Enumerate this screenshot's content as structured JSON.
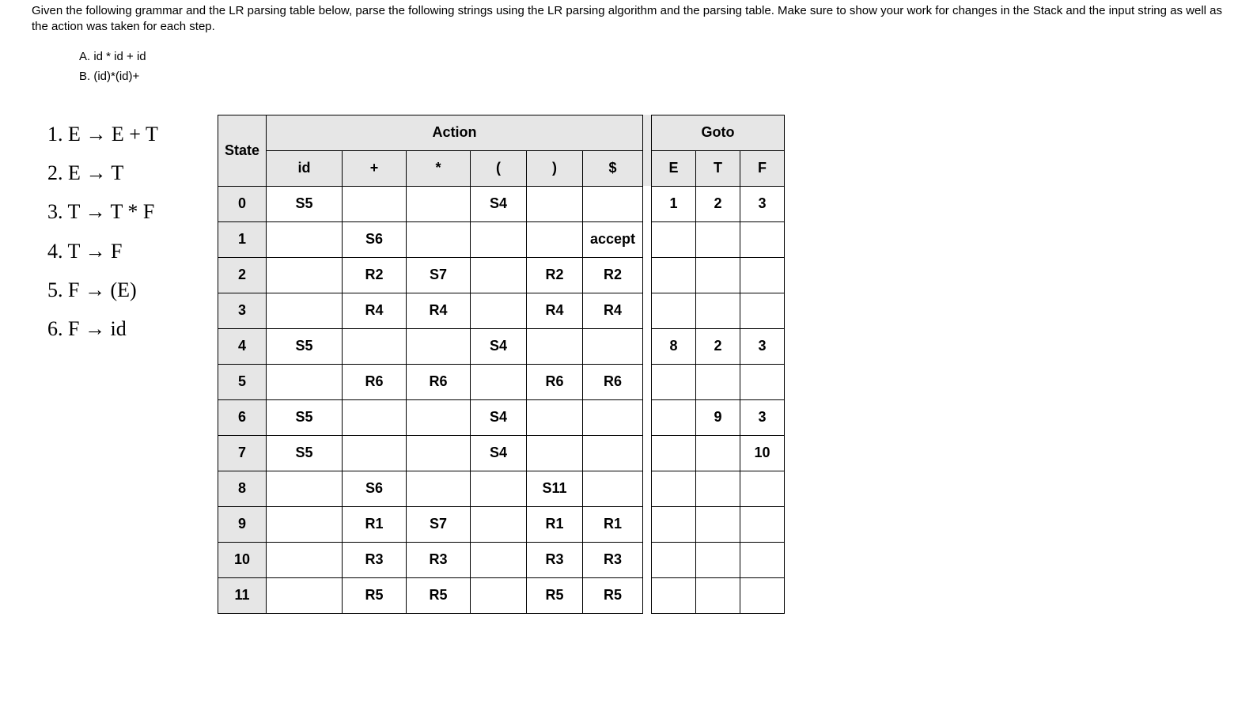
{
  "prompt": "Given the following grammar and the LR parsing table below, parse the following strings using the LR parsing algorithm and the parsing table. Make sure to show your work for changes in the Stack and the input string as well as the action was taken for each step.",
  "options": {
    "A": "A. id * id + id",
    "B": "B. (id)*(id)+"
  },
  "grammar": [
    {
      "n": "1.",
      "lhs": "E",
      "rhs": "E + T"
    },
    {
      "n": "2.",
      "lhs": "E",
      "rhs": "T"
    },
    {
      "n": "3.",
      "lhs": "T",
      "rhs": "T * F"
    },
    {
      "n": "4.",
      "lhs": "T",
      "rhs": "F"
    },
    {
      "n": "5.",
      "lhs": "F",
      "rhs": " (E)"
    },
    {
      "n": "6.",
      "lhs": "F",
      "rhs": "id"
    }
  ],
  "headers": {
    "action": "Action",
    "goto": "Goto",
    "state": "State",
    "id": "id",
    "plus": "+",
    "star": "*",
    "lp": "(",
    "rp": ")",
    "dollar": "$",
    "E": "E",
    "T": "T",
    "F": "F"
  },
  "rows": [
    {
      "s": "0",
      "id": "S5",
      "plus": "",
      "star": "",
      "lp": "S4",
      "rp": "",
      "dol": "",
      "E": "1",
      "T": "2",
      "F": "3"
    },
    {
      "s": "1",
      "id": "",
      "plus": "S6",
      "star": "",
      "lp": "",
      "rp": "",
      "dol": "accept",
      "E": "",
      "T": "",
      "F": ""
    },
    {
      "s": "2",
      "id": "",
      "plus": "R2",
      "star": "S7",
      "lp": "",
      "rp": "R2",
      "dol": "R2",
      "E": "",
      "T": "",
      "F": ""
    },
    {
      "s": "3",
      "id": "",
      "plus": "R4",
      "star": "R4",
      "lp": "",
      "rp": "R4",
      "dol": "R4",
      "E": "",
      "T": "",
      "F": ""
    },
    {
      "s": "4",
      "id": "S5",
      "plus": "",
      "star": "",
      "lp": "S4",
      "rp": "",
      "dol": "",
      "E": "8",
      "T": "2",
      "F": "3"
    },
    {
      "s": "5",
      "id": "",
      "plus": "R6",
      "star": "R6",
      "lp": "",
      "rp": "R6",
      "dol": "R6",
      "E": "",
      "T": "",
      "F": ""
    },
    {
      "s": "6",
      "id": "S5",
      "plus": "",
      "star": "",
      "lp": "S4",
      "rp": "",
      "dol": "",
      "E": "",
      "T": "9",
      "F": "3"
    },
    {
      "s": "7",
      "id": "S5",
      "plus": "",
      "star": "",
      "lp": "S4",
      "rp": "",
      "dol": "",
      "E": "",
      "T": "",
      "F": "10"
    },
    {
      "s": "8",
      "id": "",
      "plus": "S6",
      "star": "",
      "lp": "",
      "rp": "S11",
      "dol": "",
      "E": "",
      "T": "",
      "F": ""
    },
    {
      "s": "9",
      "id": "",
      "plus": "R1",
      "star": "S7",
      "lp": "",
      "rp": "R1",
      "dol": "R1",
      "E": "",
      "T": "",
      "F": ""
    },
    {
      "s": "10",
      "id": "",
      "plus": "R3",
      "star": "R3",
      "lp": "",
      "rp": "R3",
      "dol": "R3",
      "E": "",
      "T": "",
      "F": ""
    },
    {
      "s": "11",
      "id": "",
      "plus": "R5",
      "star": "R5",
      "lp": "",
      "rp": "R5",
      "dol": "R5",
      "E": "",
      "T": "",
      "F": ""
    }
  ]
}
